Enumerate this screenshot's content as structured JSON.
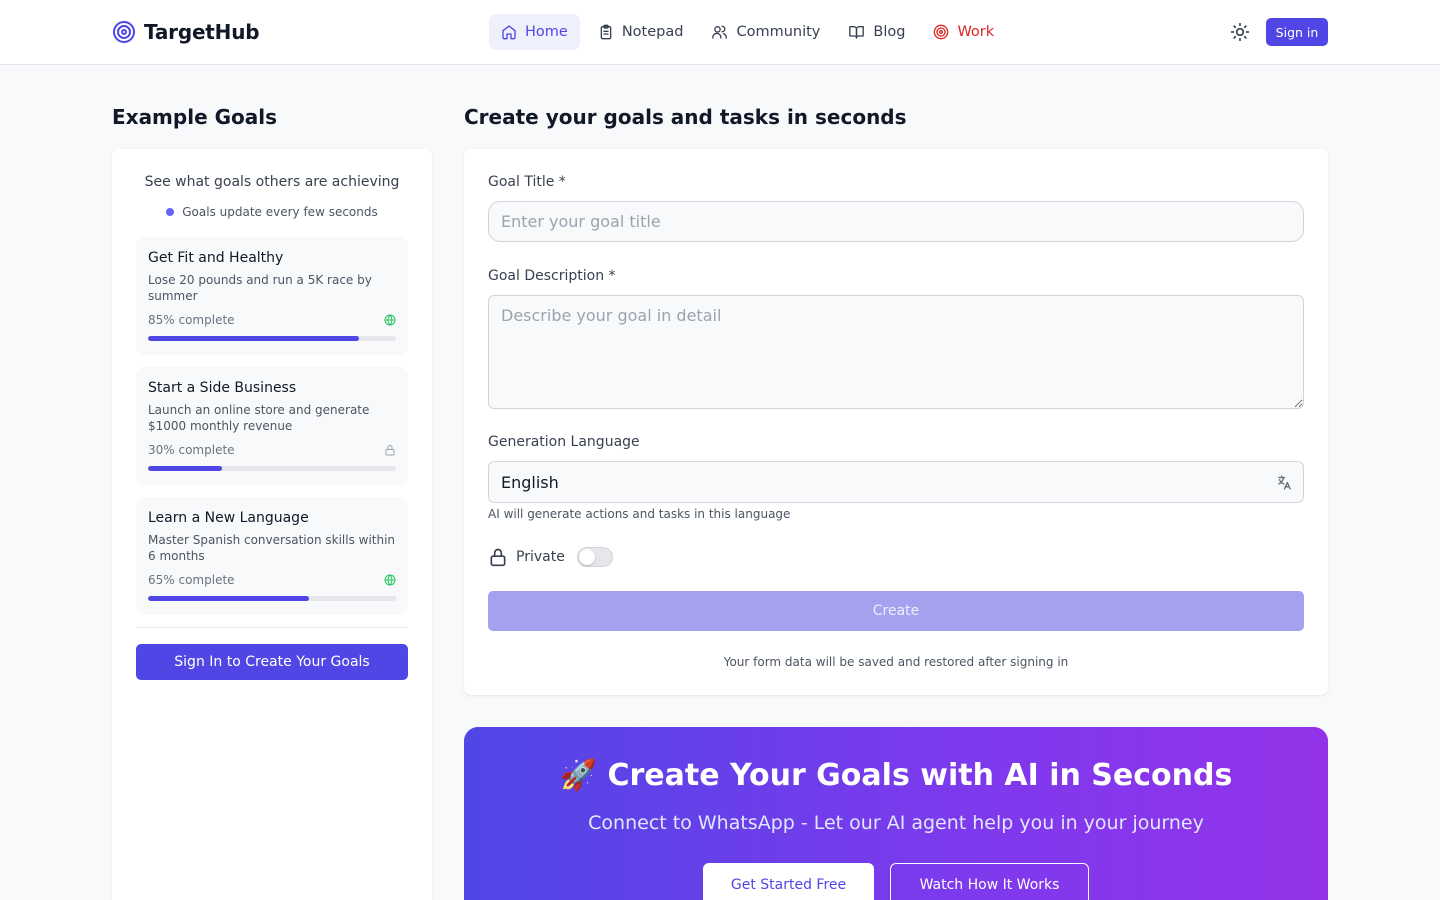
{
  "header": {
    "app_name": "TargetHub",
    "nav": [
      {
        "label": "Home",
        "icon": "home-icon"
      },
      {
        "label": "Notepad",
        "icon": "clipboard-icon"
      },
      {
        "label": "Community",
        "icon": "users-icon"
      },
      {
        "label": "Blog",
        "icon": "book-icon"
      },
      {
        "label": "Work",
        "icon": "target-icon"
      }
    ],
    "active_nav": "Home",
    "sign_in_label": "Sign in"
  },
  "sidebar": {
    "title": "Example Goals",
    "subtitle": "See what goals others are achieving",
    "note": "Goals update every few seconds",
    "goals": [
      {
        "title": "Get Fit and Healthy",
        "description": "Lose 20 pounds and run a 5K race by summer",
        "progress_label": "85% complete",
        "progress": 85,
        "visibility_icon": "globe-icon"
      },
      {
        "title": "Start a Side Business",
        "description": "Launch an online store and generate $1000 monthly revenue",
        "progress_label": "30% complete",
        "progress": 30,
        "visibility_icon": "lock-icon"
      },
      {
        "title": "Learn a New Language",
        "description": "Master Spanish conversation skills within 6 months",
        "progress_label": "65% complete",
        "progress": 65,
        "visibility_icon": "globe-icon"
      }
    ],
    "cta_label": "Sign In to Create Your Goals"
  },
  "form": {
    "heading": "Create your goals and tasks in seconds",
    "title_label": "Goal Title *",
    "title_placeholder": "Enter your goal title",
    "title_value": "",
    "description_label": "Goal Description *",
    "description_placeholder": "Describe your goal in detail",
    "description_value": "",
    "language_label": "Generation Language",
    "language_value": "English",
    "language_helper": "AI will generate actions and tasks in this language",
    "private_label": "Private",
    "private_on": false,
    "create_label": "Create",
    "footer_note": "Your form data will be saved and restored after signing in"
  },
  "promo": {
    "title": "🚀 Create Your Goals with AI in Seconds",
    "subtitle": "Connect to WhatsApp - Let our AI agent help you in your journey",
    "primary_label": "Get Started Free",
    "secondary_label": "Watch How It Works"
  },
  "colors": {
    "accent": "#4f46e5",
    "work": "#dc2626",
    "globe": "#22c55e",
    "gradient_start": "#4f46e5",
    "gradient_end": "#9333ea"
  }
}
